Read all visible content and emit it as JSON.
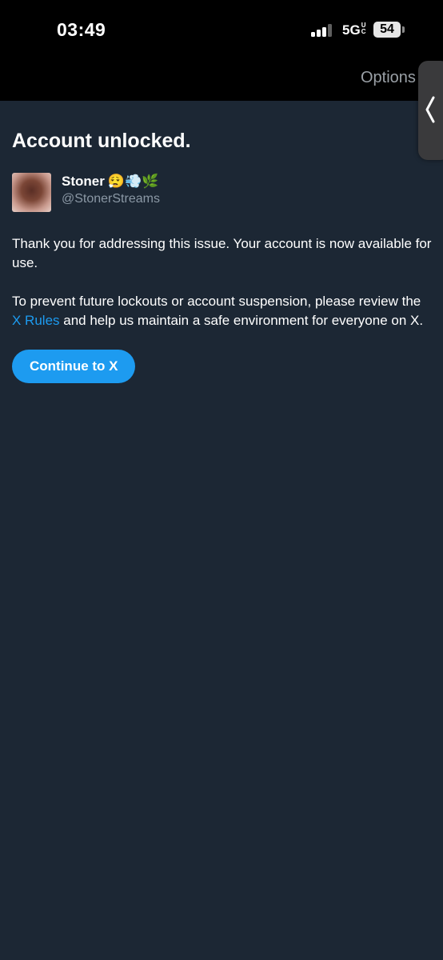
{
  "status_bar": {
    "time": "03:49",
    "network": "5G",
    "network_suffix": "UC",
    "battery": "54"
  },
  "header": {
    "options_label": "Options"
  },
  "main": {
    "title": "Account unlocked.",
    "user": {
      "name": "Stoner",
      "emoji": "😮‍💨💨🌿",
      "handle": "@StonerStreams"
    },
    "paragraph1": "Thank you for addressing this issue. Your account is now available for use.",
    "paragraph2_before": "To prevent future lockouts or account suspension, please review the ",
    "paragraph2_link": "X Rules",
    "paragraph2_after": " and help us maintain a safe environment for everyone on X.",
    "continue_label": "Continue to X"
  },
  "colors": {
    "background": "#1c2734",
    "top_bar": "#000000",
    "accent": "#1d9bf0",
    "secondary_text": "#8b98a5"
  },
  "icons": {
    "side_handle": "chevron-left-icon",
    "signal": "cellular-signal-icon",
    "battery": "battery-icon"
  }
}
